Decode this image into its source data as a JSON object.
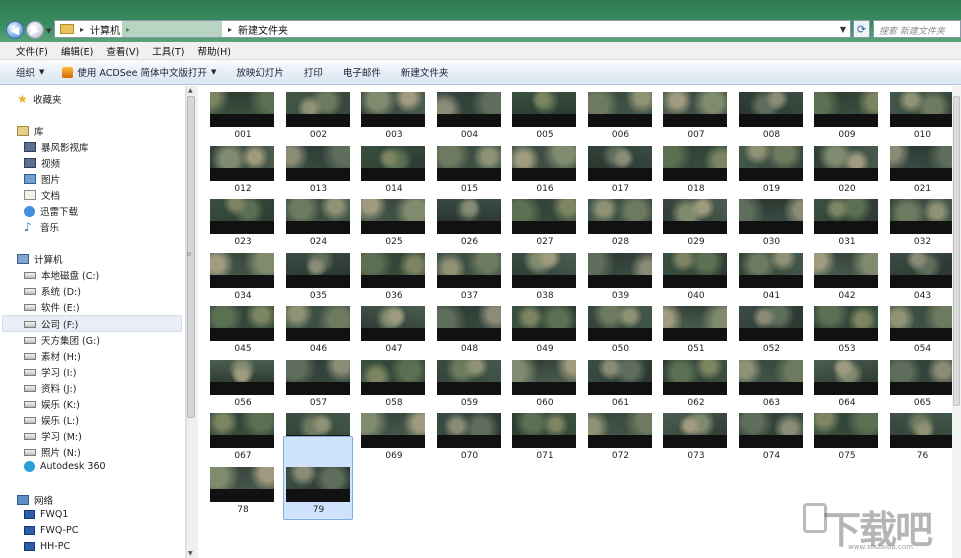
{
  "address_bar": {
    "crumbs": [
      "计算机",
      "新建文件夹"
    ],
    "search_placeholder": "搜索 新建文件夹"
  },
  "menu": [
    "文件(F)",
    "编辑(E)",
    "查看(V)",
    "工具(T)",
    "帮助(H)"
  ],
  "toolbar": {
    "organize": "组织",
    "open_with": "使用 ACDSee 简体中文版打开",
    "slideshow": "放映幻灯片",
    "print": "打印",
    "email": "电子邮件",
    "new_folder": "新建文件夹"
  },
  "nav": {
    "favorites": "收藏夹",
    "libraries": "库",
    "library_items": [
      "暴风影视库",
      "视频",
      "图片",
      "文档",
      "迅雷下载",
      "音乐"
    ],
    "computer": "计算机",
    "drives": [
      "本地磁盘 (C:)",
      "系统 (D:)",
      "软件 (E:)",
      "公司 (F:)",
      "天方集团 (G:)",
      "素材 (H:)",
      "学习 (I:)",
      "资料 (J:)",
      "娱乐 (K:)",
      "娱乐 (L:)",
      "学习 (M:)",
      "照片 (N:)",
      "Autodesk 360"
    ],
    "network": "网络",
    "network_items": [
      "FWQ1",
      "FWQ-PC",
      "HH-PC"
    ]
  },
  "files": [
    "001",
    "002",
    "003",
    "004",
    "005",
    "006",
    "007",
    "008",
    "009",
    "010",
    "012",
    "013",
    "014",
    "015",
    "016",
    "017",
    "018",
    "019",
    "020",
    "021",
    "023",
    "024",
    "025",
    "026",
    "027",
    "028",
    "029",
    "030",
    "031",
    "032",
    "034",
    "035",
    "036",
    "037",
    "038",
    "039",
    "040",
    "041",
    "042",
    "043",
    "045",
    "046",
    "047",
    "048",
    "049",
    "050",
    "051",
    "052",
    "053",
    "054",
    "056",
    "057",
    "058",
    "059",
    "060",
    "061",
    "062",
    "063",
    "064",
    "065",
    "067",
    "068",
    "069",
    "070",
    "071",
    "072",
    "073",
    "074",
    "075",
    "76",
    "78",
    "79"
  ],
  "selected_file": "79",
  "watermark": {
    "text": "下载吧",
    "sub": "www.xiazaiba.com"
  }
}
